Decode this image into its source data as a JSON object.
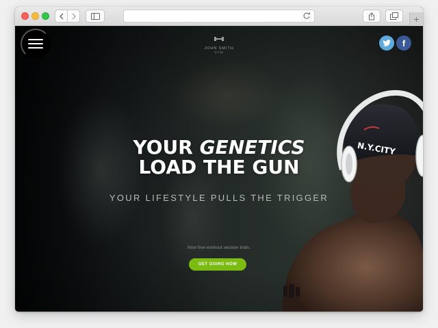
{
  "browser": {
    "new_tab_label": "+"
  },
  "site": {
    "logo": {
      "name": "JOHN SMITH",
      "subtitle": "GYM"
    },
    "cap_text": "N.Y.CITY",
    "hero": {
      "title_line1_a": "YOUR",
      "title_line1_b": "GENETICS",
      "title_line2": "LOAD THE GUN",
      "subtitle": "YOUR LIFESTYLE PULLS THE TRIGGER",
      "promo_text": "Now free workout session trials.",
      "cta_label": "GET GOING NOW"
    },
    "social": {
      "facebook_label": "f"
    }
  },
  "colors": {
    "cta": "#7cbb12",
    "twitter": "#5ea9dd",
    "facebook": "#3b5998"
  }
}
